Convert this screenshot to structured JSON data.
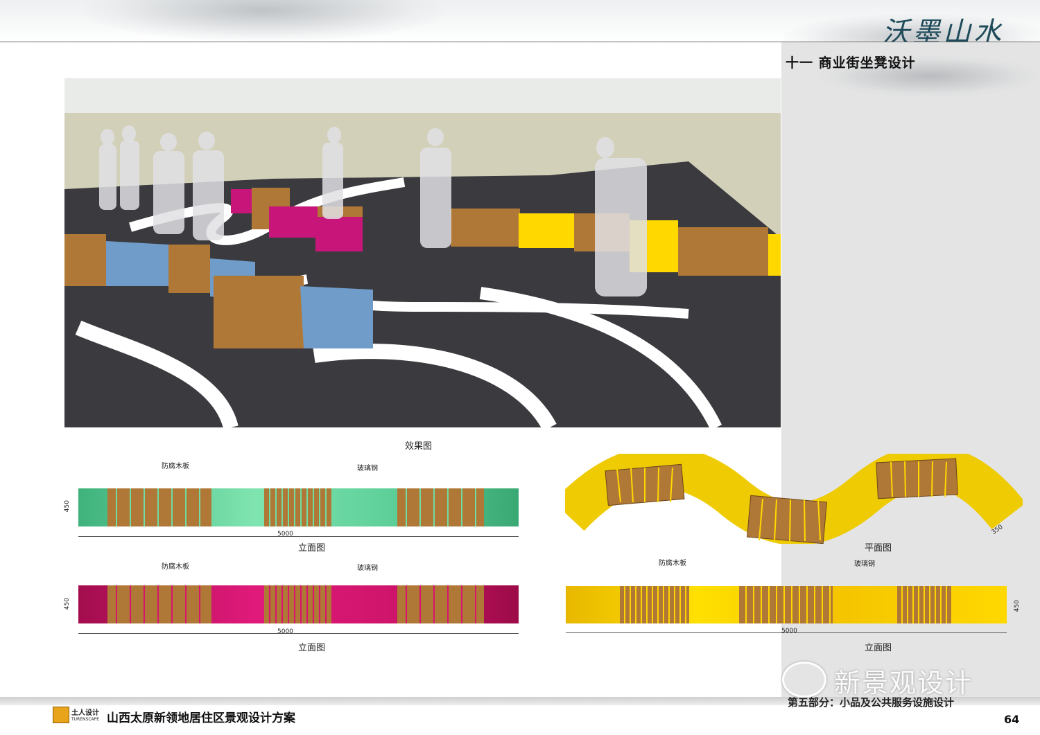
{
  "header": {
    "calligraphy": "沃墨山水",
    "section_title": "十一  商业街坐凳设计"
  },
  "render": {
    "caption": "效果图",
    "dim_label": "350"
  },
  "elevations": [
    {
      "id": "green",
      "label_wood": "防腐木板",
      "label_frp": "玻璃钢",
      "height": "450",
      "length": "5000",
      "caption": "立面图",
      "color": "#6fdca3"
    },
    {
      "id": "magenta",
      "label_wood": "防腐木板",
      "label_frp": "玻璃钢",
      "height": "450",
      "length": "5000",
      "caption": "立面图",
      "color": "#d8146e"
    },
    {
      "id": "yellow",
      "label_wood": "防腐木板",
      "label_frp": "玻璃钢",
      "height": "450",
      "length": "5000",
      "caption": "立面图",
      "color": "#ffd400"
    }
  ],
  "plan": {
    "caption": "平面图",
    "width": "350"
  },
  "footer": {
    "brand": "土人设计",
    "brand_en": "TURENSCAPE",
    "project_title": "山西太原新领地居住区景观设计方案",
    "part": "第五部分：小品及公共服务设施设计",
    "page": "64",
    "watermark": "新景观设计"
  },
  "colors": {
    "wood": "#b07836",
    "blue": "#6f9cc9",
    "magenta": "#c8157a",
    "yellow": "#ffd800",
    "ground": "#3b3b3f"
  }
}
